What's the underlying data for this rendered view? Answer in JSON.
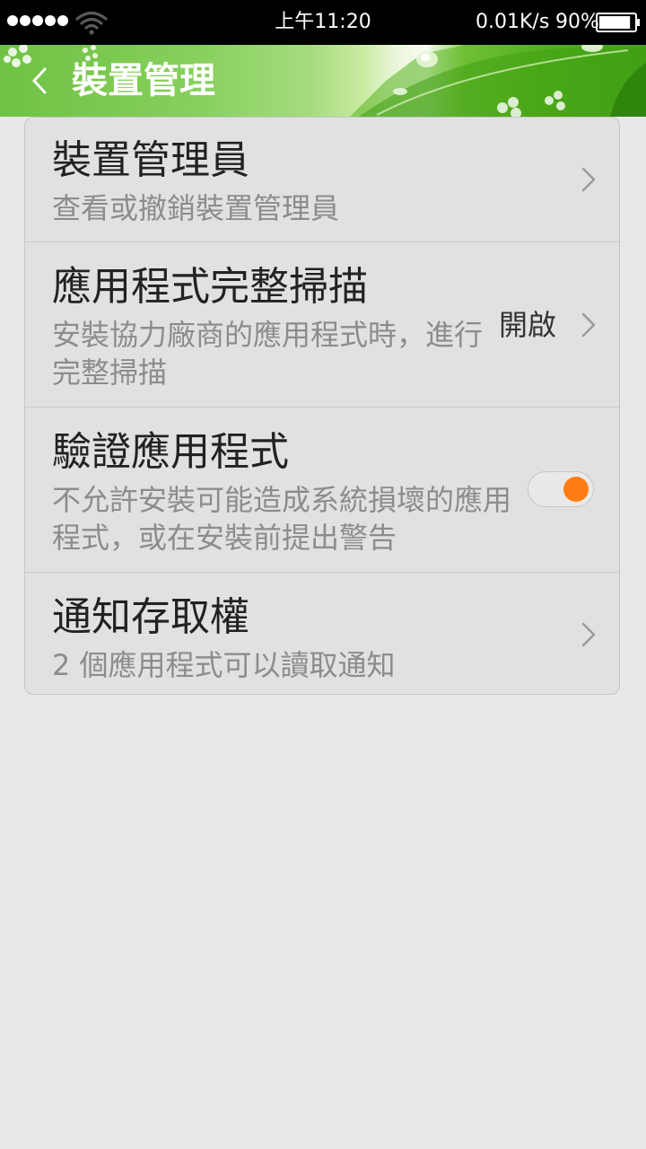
{
  "status_bar": {
    "time": "上午11:20",
    "net_speed": "0.01K/s",
    "battery_percent": "90%",
    "battery_level": 0.9,
    "signal_bars": 5,
    "icons": [
      "signal-dots-icon",
      "wifi-icon",
      "battery-icon"
    ]
  },
  "header": {
    "title": "裝置管理",
    "back_icon": "chevron-left-icon",
    "accent_color": "#4caf1f"
  },
  "settings": {
    "items": [
      {
        "title": "裝置管理員",
        "subtitle": "查看或撤銷裝置管理員",
        "control": "chevron"
      },
      {
        "title": "應用程式完整掃描",
        "subtitle": "安裝協力廠商的應用程式時，進行完整掃描",
        "value": "開啟",
        "control": "chevron"
      },
      {
        "title": "驗證應用程式",
        "subtitle": "不允許安裝可能造成系統損壞的應用程式，或在安裝前提出警告",
        "control": "toggle",
        "toggle_on": true,
        "toggle_color": "#ff7d12"
      },
      {
        "title": "通知存取權",
        "subtitle": "2 個應用程式可以讀取通知",
        "control": "chevron"
      }
    ]
  }
}
